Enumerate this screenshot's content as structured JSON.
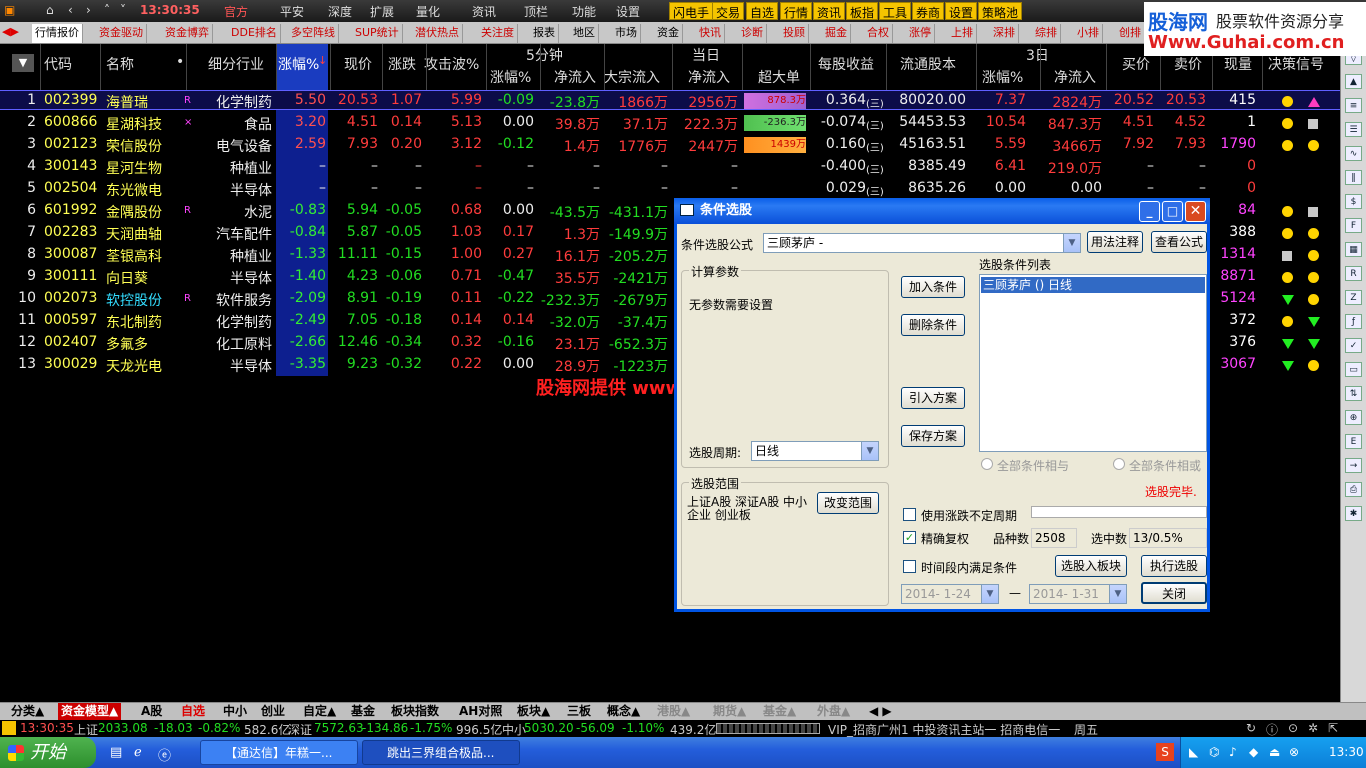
{
  "topbar": {
    "time": "13:30:35",
    "menu": [
      "官方",
      "平安",
      "深度",
      "扩展",
      "量化",
      "资讯",
      "顶栏",
      "功能",
      "设置"
    ],
    "yellow_buttons": [
      "闪电手",
      "交易",
      "自选",
      "行情",
      "资讯",
      "板指",
      "工具",
      "券商",
      "设置",
      "策略池"
    ],
    "watermark_site": "股海网",
    "watermark_slogan": "股票软件资源分享",
    "watermark_url": "Www.Guhai.com.cn"
  },
  "tabs": [
    "行情报价",
    "资金驱动",
    "资金博弈",
    "DDE排名",
    "多空阵线",
    "SUP统计",
    "潜伏热点",
    "关注度",
    "报表",
    "地区",
    "市场",
    "资金",
    "快讯",
    "诊断",
    "投顾",
    "掘金",
    "合权",
    "涨停",
    "上排",
    "深排",
    "综排",
    "小排",
    "创排"
  ],
  "columns": {
    "code": "代码",
    "name": "名称",
    "industry": "细分行业",
    "chg_pct": "涨幅%",
    "price": "现价",
    "change": "涨跌",
    "attack": "攻击波%",
    "g5min": "5分钟",
    "g5_chg": "涨幅%",
    "g5_flow": "净流入",
    "gday": "当日",
    "big_flow": "大宗流入",
    "day_flow": "净流入",
    "super": "超大单",
    "eps": "每股收益",
    "float_shares": "流通股本",
    "g3d": "3日",
    "d3_chg": "涨幅%",
    "d3_flow": "净流入",
    "bid": "买价",
    "ask": "卖价",
    "vol": "现量",
    "signal": "决策信号"
  },
  "rows": [
    {
      "n": "1",
      "code": "002399",
      "name": "海普瑞",
      "mark": "R",
      "ind": "化学制药",
      "chg": "5.50",
      "price": "20.53",
      "change": "1.07",
      "attack": "5.99",
      "f5c": "-0.09",
      "f5f": "-23.8万",
      "big": "1866万",
      "day": "2956万",
      "sup": "878.3万",
      "eps": "0.364",
      "q": "(三)",
      "float": "80020.00",
      "d3c": "7.37",
      "d3f": "2824万",
      "bid": "20.52",
      "ask": "20.53",
      "vol": "415",
      "s1": "dot",
      "s2": "triup"
    },
    {
      "n": "2",
      "code": "600866",
      "name": "星湖科技",
      "mark": "×",
      "ind": "食品",
      "chg": "3.20",
      "price": "4.51",
      "change": "0.14",
      "attack": "5.13",
      "f5c": "0.00",
      "f5f": "39.8万",
      "big": "37.1万",
      "day": "222.3万",
      "sup": "-236.3万",
      "eps": "-0.074",
      "q": "(三)",
      "float": "54453.53",
      "d3c": "10.54",
      "d3f": "847.3万",
      "bid": "4.51",
      "ask": "4.52",
      "vol": "1",
      "s1": "dot",
      "s2": "sq"
    },
    {
      "n": "3",
      "code": "002123",
      "name": "荣信股份",
      "mark": "",
      "ind": "电气设备",
      "chg": "2.59",
      "price": "7.93",
      "change": "0.20",
      "attack": "3.12",
      "f5c": "-0.12",
      "f5f": "1.4万",
      "big": "1776万",
      "day": "2447万",
      "sup": "1439万",
      "eps": "0.160",
      "q": "(三)",
      "float": "45163.51",
      "d3c": "5.59",
      "d3f": "3466万",
      "bid": "7.92",
      "ask": "7.93",
      "vol": "1790",
      "s1": "dot",
      "s2": "dot"
    },
    {
      "n": "4",
      "code": "300143",
      "name": "星河生物",
      "mark": "",
      "ind": "种植业",
      "chg": "–",
      "price": "–",
      "change": "–",
      "attack": "–",
      "f5c": "–",
      "f5f": "–",
      "big": "–",
      "day": "–",
      "sup": "",
      "eps": "-0.400",
      "q": "(三)",
      "float": "8385.49",
      "d3c": "6.41",
      "d3f": "219.0万",
      "bid": "–",
      "ask": "–",
      "vol": "0",
      "s1": "",
      "s2": ""
    },
    {
      "n": "5",
      "code": "002504",
      "name": "东光微电",
      "mark": "",
      "ind": "半导体",
      "chg": "–",
      "price": "–",
      "change": "–",
      "attack": "–",
      "f5c": "–",
      "f5f": "–",
      "big": "–",
      "day": "–",
      "sup": "",
      "eps": "0.029",
      "q": "(三)",
      "float": "8635.26",
      "d3c": "0.00",
      "d3f": "0.00",
      "bid": "–",
      "ask": "–",
      "vol": "0",
      "s1": "",
      "s2": ""
    },
    {
      "n": "6",
      "code": "601992",
      "name": "金隅股份",
      "mark": "R",
      "ind": "水泥",
      "chg": "-0.83",
      "price": "5.94",
      "change": "-0.05",
      "attack": "0.68",
      "f5c": "0.00",
      "f5f": "-43.5万",
      "big": "-431.1万",
      "day": "",
      "sup": "",
      "eps": "",
      "q": "",
      "float": "",
      "d3c": "",
      "d3f": "",
      "bid": "",
      "ask": "",
      "vol": "84",
      "s1": "dot",
      "s2": "sq"
    },
    {
      "n": "7",
      "code": "002283",
      "name": "天润曲轴",
      "mark": "",
      "ind": "汽车配件",
      "chg": "-0.84",
      "price": "5.87",
      "change": "-0.05",
      "attack": "1.03",
      "f5c": "0.17",
      "f5f": "1.3万",
      "big": "-149.9万",
      "day": "",
      "sup": "",
      "eps": "",
      "q": "",
      "float": "",
      "d3c": "",
      "d3f": "",
      "bid": "",
      "ask": "",
      "vol": "388",
      "s1": "dot",
      "s2": "dot"
    },
    {
      "n": "8",
      "code": "300087",
      "name": "荃银高科",
      "mark": "",
      "ind": "种植业",
      "chg": "-1.33",
      "price": "11.11",
      "change": "-0.15",
      "attack": "1.00",
      "f5c": "0.27",
      "f5f": "16.1万",
      "big": "-205.2万",
      "day": "",
      "sup": "",
      "eps": "",
      "q": "",
      "float": "",
      "d3c": "",
      "d3f": "",
      "bid": "",
      "ask": "",
      "vol": "1314",
      "s1": "sq",
      "s2": "dot"
    },
    {
      "n": "9",
      "code": "300111",
      "name": "向日葵",
      "mark": "",
      "ind": "半导体",
      "chg": "-1.40",
      "price": "4.23",
      "change": "-0.06",
      "attack": "0.71",
      "f5c": "-0.47",
      "f5f": "35.5万",
      "big": "-2421万",
      "day": "",
      "sup": "",
      "eps": "",
      "q": "",
      "float": "",
      "d3c": "",
      "d3f": "",
      "bid": "",
      "ask": "",
      "vol": "8871",
      "s1": "dot",
      "s2": "dot"
    },
    {
      "n": "10",
      "code": "002073",
      "name": "软控股份",
      "mark": "R",
      "ind": "软件服务",
      "chg": "-2.09",
      "price": "8.91",
      "change": "-0.19",
      "attack": "0.11",
      "f5c": "-0.22",
      "f5f": "-232.3万",
      "big": "-2679万",
      "day": "",
      "sup": "",
      "eps": "",
      "q": "",
      "float": "",
      "d3c": "",
      "d3f": "",
      "bid": "",
      "ask": "",
      "vol": "5124",
      "s1": "tri",
      "s2": "dot"
    },
    {
      "n": "11",
      "code": "000597",
      "name": "东北制药",
      "mark": "",
      "ind": "化学制药",
      "chg": "-2.49",
      "price": "7.05",
      "change": "-0.18",
      "attack": "0.14",
      "f5c": "0.14",
      "f5f": "-32.0万",
      "big": "-37.4万",
      "day": "",
      "sup": "",
      "eps": "",
      "q": "",
      "float": "",
      "d3c": "",
      "d3f": "",
      "bid": "",
      "ask": "",
      "vol": "372",
      "s1": "dot",
      "s2": "tri"
    },
    {
      "n": "12",
      "code": "002407",
      "name": "多氟多",
      "mark": "",
      "ind": "化工原料",
      "chg": "-2.66",
      "price": "12.46",
      "change": "-0.34",
      "attack": "0.32",
      "f5c": "-0.16",
      "f5f": "23.1万",
      "big": "-652.3万",
      "day": "",
      "sup": "",
      "eps": "",
      "q": "",
      "float": "",
      "d3c": "",
      "d3f": "",
      "bid": "",
      "ask": "",
      "vol": "376",
      "s1": "tri",
      "s2": "tri"
    },
    {
      "n": "13",
      "code": "300029",
      "name": "天龙光电",
      "mark": "",
      "ind": "半导体",
      "chg": "-3.35",
      "price": "9.23",
      "change": "-0.32",
      "attack": "0.22",
      "f5c": "0.00",
      "f5f": "28.9万",
      "big": "-1223万",
      "day": "",
      "sup": "",
      "eps": "",
      "q": "",
      "float": "",
      "d3c": "",
      "d3f": "",
      "bid": "",
      "ask": "",
      "vol": "3067",
      "s1": "tri",
      "s2": "dot"
    }
  ],
  "overlay_text": "股海网提供 www.guhai.com.cn",
  "dialog": {
    "title": "条件选股",
    "formula_label": "条件选股公式",
    "formula_value": "三顾茅庐 -",
    "usage_btn": "用法注释",
    "view_btn": "查看公式",
    "params_group": "计算参数",
    "params_text": "无参数需要设置",
    "add_btn": "加入条件",
    "delete_btn": "删除条件",
    "import_btn": "引入方案",
    "save_btn": "保存方案",
    "list_label": "选股条件列表",
    "list_items": [
      "三顾茅庐 () 日线"
    ],
    "period_label": "选股周期:",
    "period_value": "日线",
    "and_label": "全部条件相与",
    "or_label": "全部条件相或",
    "status": "选股完毕.",
    "range_group": "选股范围",
    "range_text": "上证A股 深证A股 中小企业 创业板",
    "change_range_btn": "改变范围",
    "uncertain_period": "使用涨跌不定周期",
    "exact_reweight": "精确复权",
    "count_label": "品种数",
    "count_value": "2508",
    "selected_label": "选中数",
    "selected_value": "13/0.5%",
    "time_range": "时间段内满足条件",
    "date_from": "2014- 1-24",
    "date_to": "2014- 1-31",
    "to_sep": "—",
    "to_block_btn": "选股入板块",
    "execute_btn": "执行选股",
    "close_btn": "关闭"
  },
  "bottom_tabs": [
    "分类▲",
    "资金模型▲",
    "A股",
    "自选",
    "中小",
    "创业",
    "自定▲",
    "基金",
    "板块指数",
    "AH对照",
    "板块▲",
    "三板",
    "概念▲",
    "港股▲",
    "期货▲",
    "基金▲",
    "外盘▲"
  ],
  "status": {
    "time": "13:30:35",
    "sh_label": "上证",
    "sh_value": "2033.08",
    "sh_change": "-18.03",
    "sh_pct": "-0.82%",
    "sh_amount": "582.6亿",
    "sz_label": "深证",
    "sz_value": "7572.63",
    "sz_change": "-134.86",
    "sz_pct": "-1.75%",
    "sz_amount": "996.5亿",
    "zx_label": "中小",
    "zx_value": "5030.20",
    "zx_change": "-56.09",
    "zx_pct": "-1.10%",
    "zx_amount": "439.2亿",
    "server": "VIP_招商广州1  中投资讯主站一  招商电信一",
    "weekday": "周五"
  },
  "taskbar": {
    "start": "开始",
    "task1": "【通达信】年糕一...",
    "task2": "跳出三界组合极品...",
    "clock": "13:30"
  },
  "colors": {
    "up": "#ff3c3c",
    "down": "#22dd22",
    "accent": "#0054e3"
  }
}
